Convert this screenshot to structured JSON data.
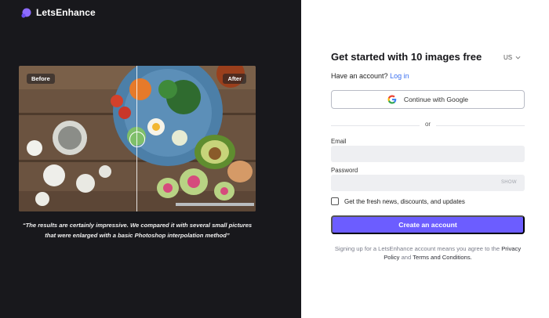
{
  "brand": {
    "name": "LetsEnhance",
    "accent": "#8d6cff"
  },
  "hero": {
    "before_label": "Before",
    "after_label": "After",
    "quote": "“The results are certainly impressive. We compared it with several small pictures that were enlarged with a basic Photoshop interpolation method”"
  },
  "form": {
    "title": "Get started with 10 images free",
    "language": "US",
    "have_account": "Have an account?",
    "login_link": "Log in",
    "google_button": "Continue with Google",
    "or_text": "or",
    "email_label": "Email",
    "email_value": "",
    "password_label": "Password",
    "password_value": "",
    "show_label": "SHOW",
    "newsletter_label": "Get the fresh news, discounts, and updates",
    "newsletter_checked": false,
    "create_button": "Create an account",
    "terms_prefix": "Signing up for a LetsEnhance account means you agree to the",
    "privacy_link": "Privacy Policy",
    "terms_and": "and",
    "terms_link": "Terms and Conditions.",
    "accent_color": "#6c5dff"
  }
}
